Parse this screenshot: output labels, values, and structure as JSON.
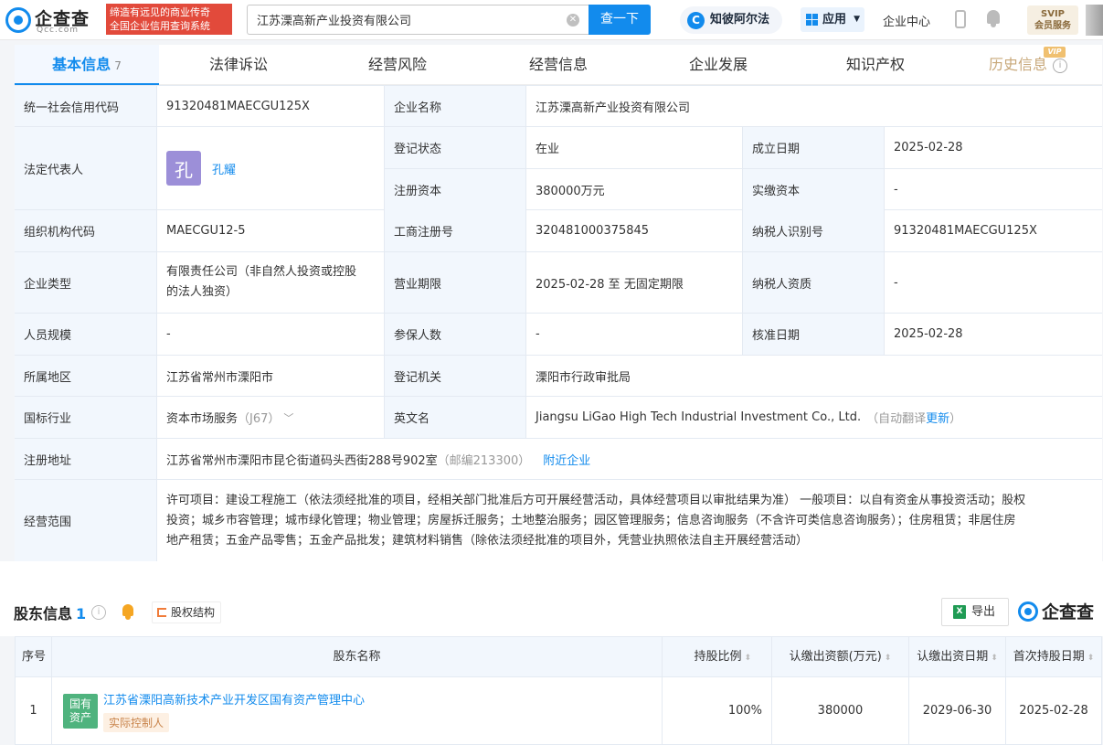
{
  "header": {
    "logo_name": "企查查",
    "logo_domain": "Qcc.com",
    "slogan_line1": "缔造有远见的商业传奇",
    "slogan_line2": "全国企业信用查询系统",
    "search_value": "江苏溧高新产业投资有限公司",
    "search_button": "查一下",
    "zhibi_label": "知彼阿尔法",
    "apps_label": "应用",
    "enterprise_center": "企业中心",
    "svip_line1": "SVIP",
    "svip_line2": "会员服务"
  },
  "tabs": [
    {
      "label": "基本信息",
      "count": "7"
    },
    {
      "label": "法律诉讼"
    },
    {
      "label": "经营风险"
    },
    {
      "label": "经营信息"
    },
    {
      "label": "企业发展"
    },
    {
      "label": "知识产权"
    },
    {
      "label": "历史信息",
      "badge": "VIP"
    }
  ],
  "info": {
    "credit_code_label": "统一社会信用代码",
    "credit_code": "91320481MAECGU125X",
    "name_label": "企业名称",
    "name": "江苏溧高新产业投资有限公司",
    "legal_rep_label": "法定代表人",
    "legal_rep_avatar": "孔",
    "legal_rep": "孔耀",
    "reg_status_label": "登记状态",
    "reg_status": "在业",
    "founded_label": "成立日期",
    "founded": "2025-02-28",
    "reg_capital_label": "注册资本",
    "reg_capital": "380000万元",
    "paid_capital_label": "实缴资本",
    "paid_capital": "-",
    "org_code_label": "组织机构代码",
    "org_code": "MAECGU12-5",
    "biz_reg_no_label": "工商注册号",
    "biz_reg_no": "320481000375845",
    "taxpayer_id_label": "纳税人识别号",
    "taxpayer_id": "91320481MAECGU125X",
    "type_label": "企业类型",
    "type_line1": "有限责任公司（非自然人投资或控股",
    "type_line2": "的法人独资）",
    "term_label": "营业期限",
    "term": "2025-02-28 至 无固定期限",
    "taxpayer_qual_label": "纳税人资质",
    "taxpayer_qual": "-",
    "staff_label": "人员规模",
    "staff": "-",
    "insured_label": "参保人数",
    "insured": "-",
    "approved_label": "核准日期",
    "approved": "2025-02-28",
    "region_label": "所属地区",
    "region": "江苏省常州市溧阳市",
    "authority_label": "登记机关",
    "authority": "溧阳市行政审批局",
    "industry_label": "国标行业",
    "industry": "资本市场服务",
    "industry_code": "（J67）",
    "english_label": "英文名",
    "english": "Jiangsu LiGao High Tech Industrial Investment Co., Ltd.",
    "english_note": "（自动翻译",
    "english_update": "更新",
    "english_note_end": "）",
    "address_label": "注册地址",
    "address": "江苏省常州市溧阳市昆仑街道码头西街288号902室",
    "postcode": "（邮编213300）",
    "nearby": "附近企业",
    "scope_label": "经营范围",
    "scope_line1": "许可项目：建设工程施工（依法须经批准的项目，经相关部门批准后方可开展经营活动，具体经营项目以审批结果为准） 一般项目：以自有资金从事投资活动；股权",
    "scope_line2": "投资；城乡市容管理；城市绿化管理；物业管理；房屋拆迁服务；土地整治服务；园区管理服务；信息咨询服务（不含许可类信息咨询服务）；住房租赁；非居住房",
    "scope_line3": "地产租赁；五金产品零售；五金产品批发；建筑材料销售（除依法须经批准的项目外，凭营业执照依法自主开展经营活动）"
  },
  "shareholders": {
    "title": "股东信息",
    "count": "1",
    "equity_button": "股权结构",
    "export_button": "导出",
    "brand": "企查查",
    "columns": [
      "序号",
      "股东名称",
      "持股比例",
      "认缴出资额(万元)",
      "认缴出资日期",
      "首次持股日期"
    ],
    "rows": [
      {
        "index": "1",
        "logo_line1": "国有",
        "logo_line2": "资产",
        "name": "江苏省溧阳高新技术产业开发区国有资产管理中心",
        "tag": "实际控制人",
        "ratio": "100%",
        "amount": "380000",
        "subscribe_date": "2029-06-30",
        "first_date": "2025-02-28"
      }
    ]
  }
}
